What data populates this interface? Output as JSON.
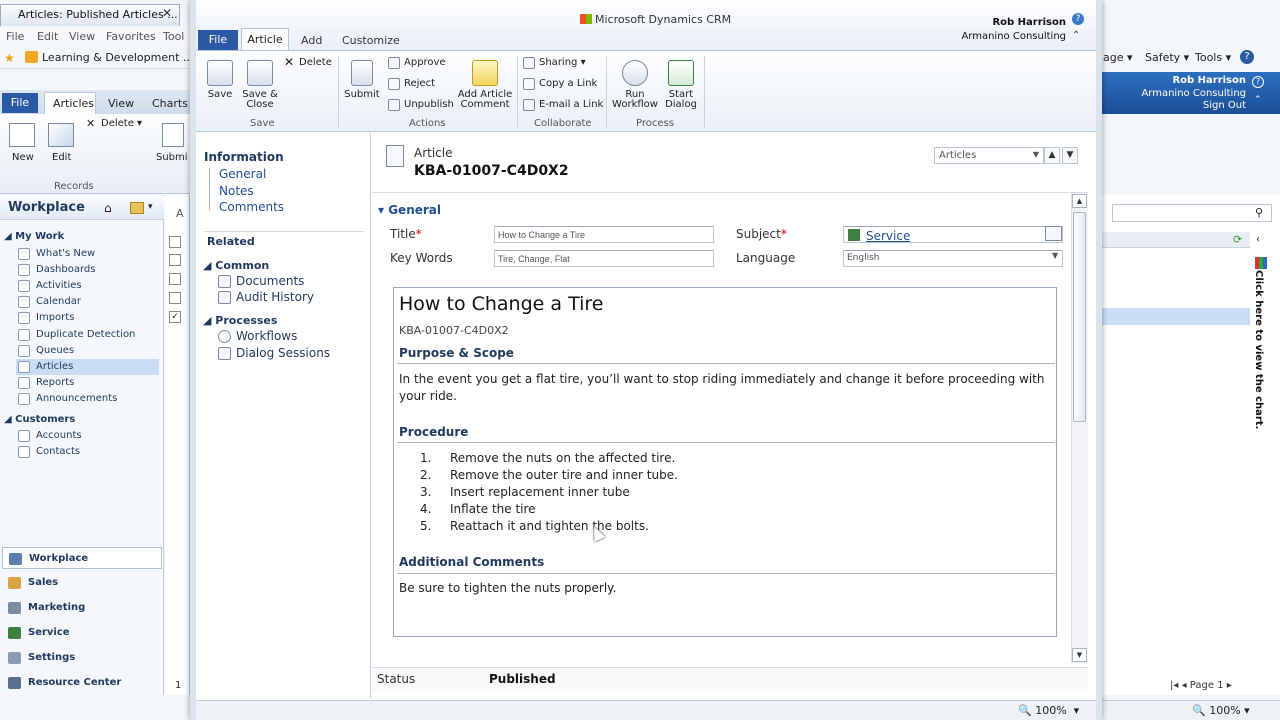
{
  "background": {
    "tab_title": "Articles: Published Articles ...",
    "menu": [
      "File",
      "Edit",
      "View",
      "Favorites",
      "Tool"
    ],
    "favorite": "Learning & Development ...",
    "right_tools": [
      "age ▾",
      "Safety ▾",
      "Tools ▾"
    ],
    "ribbon_tabs": [
      "File",
      "Articles",
      "View",
      "Charts"
    ],
    "ribbon_buttons": [
      "New",
      "Edit",
      "Delete ▾",
      "Submi"
    ],
    "records_label": "Records",
    "user": "Rob Harrison",
    "org": "Armanino Consulting",
    "sign_out": "Sign Out",
    "nav_title": "Workplace",
    "nav_groups": {
      "my_work": "My Work",
      "customers": "Customers"
    },
    "nav_items": [
      "What's New",
      "Dashboards",
      "Activities",
      "Calendar",
      "Imports",
      "Duplicate Detection",
      "Queues",
      "Articles",
      "Reports",
      "Announcements"
    ],
    "customer_items": [
      "Accounts",
      "Contacts"
    ],
    "wunderbar": [
      "Workplace",
      "Sales",
      "Marketing",
      "Service",
      "Settings",
      "Resource Center"
    ],
    "grid_col_letter": "A",
    "right_chart_hint": "Click here to view the chart.",
    "pager": "Page 1",
    "zoom": "100%",
    "grid_footer": "1"
  },
  "dialog": {
    "brand": "Microsoft Dynamics CRM",
    "user": "Rob Harrison",
    "org": "Armanino Consulting",
    "tabs": {
      "file": "File",
      "article": "Article",
      "add": "Add",
      "customize": "Customize"
    },
    "ribbon": {
      "save": "Save",
      "save_close_1": "Save &",
      "save_close_2": "Close",
      "delete": "Delete",
      "submit": "Submit",
      "approve": "Approve",
      "reject": "Reject",
      "unpublish": "Unpublish",
      "add_comment_1": "Add Article",
      "add_comment_2": "Comment",
      "sharing": "Sharing ▾",
      "copy_link": "Copy a Link",
      "email_link": "E-mail a Link",
      "run_wf_1": "Run",
      "run_wf_2": "Workflow",
      "start_dlg_1": "Start",
      "start_dlg_2": "Dialog",
      "groups": {
        "save": "Save",
        "actions": "Actions",
        "collaborate": "Collaborate",
        "process": "Process"
      }
    },
    "nav": {
      "information": "Information",
      "general": "General",
      "notes": "Notes",
      "comments": "Comments",
      "related": "Related",
      "common": "Common",
      "documents": "Documents",
      "audit_history": "Audit History",
      "processes": "Processes",
      "workflows": "Workflows",
      "dialog_sessions": "Dialog Sessions"
    },
    "header": {
      "entity": "Article",
      "number": "KBA-01007-C4D0X2",
      "form_selector": "Articles"
    },
    "section": "General",
    "fields": {
      "title_label": "Title",
      "title_value": "How to Change a Tire",
      "keywords_label": "Key Words",
      "keywords_value": "Tire, Change, Flat",
      "subject_label": "Subject",
      "subject_value": "Service",
      "language_label": "Language",
      "language_value": "English"
    },
    "article": {
      "title": "How to Change a Tire",
      "number": "KBA-01007-C4D0X2",
      "purpose_heading": "Purpose & Scope",
      "purpose_text": "In the event you get a flat tire, you’ll want to stop riding immediately and change it before proceeding with your ride.",
      "procedure_heading": "Procedure",
      "steps": [
        {
          "num": "1.",
          "text": "Remove the nuts on the affected tire."
        },
        {
          "num": "2.",
          "text": "Remove the outer tire and inner tube."
        },
        {
          "num": "3.",
          "text": "Insert replacement inner tube"
        },
        {
          "num": "4.",
          "text": "Inflate the tire"
        },
        {
          "num": "5.",
          "text": "Reattach it and tighten the bolts."
        }
      ],
      "comments_heading": "Additional Comments",
      "comments_text": "Be sure to tighten the nuts properly."
    },
    "status_label": "Status",
    "status_value": "Published",
    "zoom": "100%"
  }
}
